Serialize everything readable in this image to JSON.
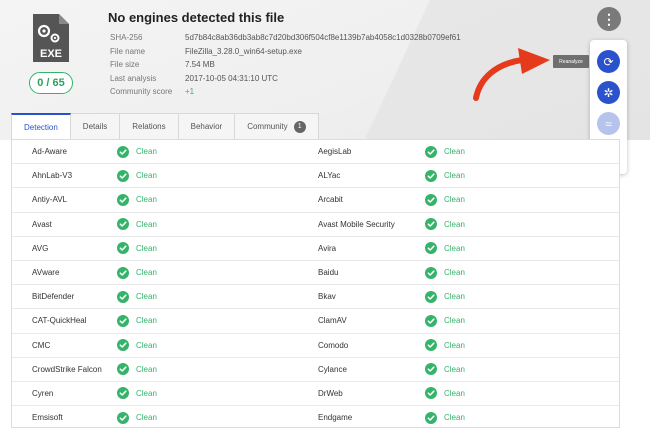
{
  "header": {
    "title": "No engines detected this file",
    "file_type_label": "EXE",
    "score": "0 / 65",
    "meta": [
      {
        "key": "SHA-256",
        "value": "5d7b84c8ab36db3ab8c7d20bd306f504cf8e1139b7ab4058c1d0328b0709ef61"
      },
      {
        "key": "File name",
        "value": "FileZilla_3.28.0_win64-setup.exe"
      },
      {
        "key": "File size",
        "value": "7.54 MB"
      },
      {
        "key": "Last analysis",
        "value": "2017-10-05 04:31:10 UTC"
      },
      {
        "key": "Community score",
        "value": "+1"
      }
    ]
  },
  "actions": {
    "more_icon": "more-vert-icon",
    "tooltip": "Reanalyze",
    "buttons": [
      {
        "name": "reanalyze-icon",
        "glyph": "⟳",
        "state": "active"
      },
      {
        "name": "graph-icon",
        "glyph": "✲",
        "state": "active"
      },
      {
        "name": "similar-icon",
        "glyph": "≈",
        "state": "disabled"
      },
      {
        "name": "download-icon",
        "glyph": "⬇",
        "state": "disabled"
      }
    ]
  },
  "tabs": [
    {
      "label": "Detection",
      "selected": true
    },
    {
      "label": "Details"
    },
    {
      "label": "Relations"
    },
    {
      "label": "Behavior"
    },
    {
      "label": "Community",
      "count": "1"
    }
  ],
  "results": [
    {
      "left": {
        "engine": "Ad-Aware",
        "result": "Clean"
      },
      "right": {
        "engine": "AegisLab",
        "result": "Clean"
      }
    },
    {
      "left": {
        "engine": "AhnLab-V3",
        "result": "Clean"
      },
      "right": {
        "engine": "ALYac",
        "result": "Clean"
      }
    },
    {
      "left": {
        "engine": "Antiy-AVL",
        "result": "Clean"
      },
      "right": {
        "engine": "Arcabit",
        "result": "Clean"
      }
    },
    {
      "left": {
        "engine": "Avast",
        "result": "Clean"
      },
      "right": {
        "engine": "Avast Mobile Security",
        "result": "Clean"
      }
    },
    {
      "left": {
        "engine": "AVG",
        "result": "Clean"
      },
      "right": {
        "engine": "Avira",
        "result": "Clean"
      }
    },
    {
      "left": {
        "engine": "AVware",
        "result": "Clean"
      },
      "right": {
        "engine": "Baidu",
        "result": "Clean"
      }
    },
    {
      "left": {
        "engine": "BitDefender",
        "result": "Clean"
      },
      "right": {
        "engine": "Bkav",
        "result": "Clean"
      }
    },
    {
      "left": {
        "engine": "CAT-QuickHeal",
        "result": "Clean"
      },
      "right": {
        "engine": "ClamAV",
        "result": "Clean"
      }
    },
    {
      "left": {
        "engine": "CMC",
        "result": "Clean"
      },
      "right": {
        "engine": "Comodo",
        "result": "Clean"
      }
    },
    {
      "left": {
        "engine": "CrowdStrike Falcon",
        "result": "Clean"
      },
      "right": {
        "engine": "Cylance",
        "result": "Clean"
      }
    },
    {
      "left": {
        "engine": "Cyren",
        "result": "Clean"
      },
      "right": {
        "engine": "DrWeb",
        "result": "Clean"
      }
    },
    {
      "left": {
        "engine": "Emsisoft",
        "result": "Clean"
      },
      "right": {
        "engine": "Endgame",
        "result": "Clean"
      }
    }
  ],
  "colors": {
    "accent": "#2a52cc",
    "clean": "#36b36b",
    "arrow": "#e53a1c"
  }
}
